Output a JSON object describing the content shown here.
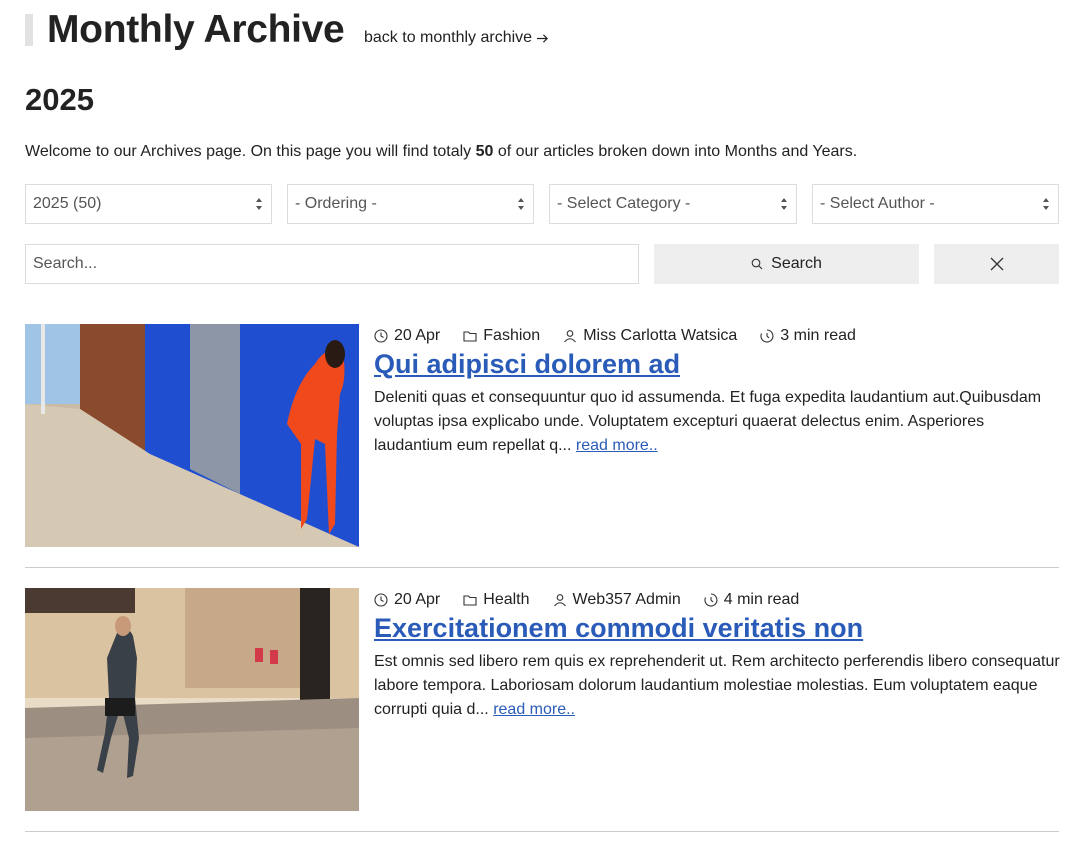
{
  "header": {
    "title": "Monthly Archive",
    "back_link": "back to monthly archive"
  },
  "year": "2025",
  "intro": {
    "before": "Welcome to our Archives page. On this page you will find totaly ",
    "count": "50",
    "after": " of our articles broken down into Months and Years."
  },
  "filters": {
    "year": "2025 (50)",
    "ordering": "- Ordering -",
    "category": "- Select Category -",
    "author": "- Select Author -"
  },
  "search": {
    "placeholder": "Search...",
    "button_label": "Search"
  },
  "articles": [
    {
      "date": "20 Apr",
      "category": "Fashion",
      "author": "Miss Carlotta Watsica",
      "read_time": "3 min read",
      "title": "Qui adipisci dolorem ad",
      "excerpt": "Deleniti quas et consequuntur quo id assumenda. Et fuga expedita laudantium aut.Quibusdam voluptas ipsa explicabo unde. Voluptatem excepturi quaerat delectus enim. Asperiores laudantium eum repellat q...",
      "read_more": "read more.."
    },
    {
      "date": "20 Apr",
      "category": "Health",
      "author": "Web357 Admin",
      "read_time": "4 min read",
      "title": "Exercitationem commodi veritatis non",
      "excerpt": "Est omnis sed libero rem quis ex reprehenderit ut. Rem architecto perferendis libero consequatur labore tempora. Laboriosam dolorum laudantium molestiae molestias. Eum voluptatem eaque corrupti quia d...",
      "read_more": "read more.."
    }
  ],
  "colors": {
    "link": "#2a5bb8",
    "button_bg": "#eeeeee",
    "accent_bar": "#e2e2e2"
  }
}
